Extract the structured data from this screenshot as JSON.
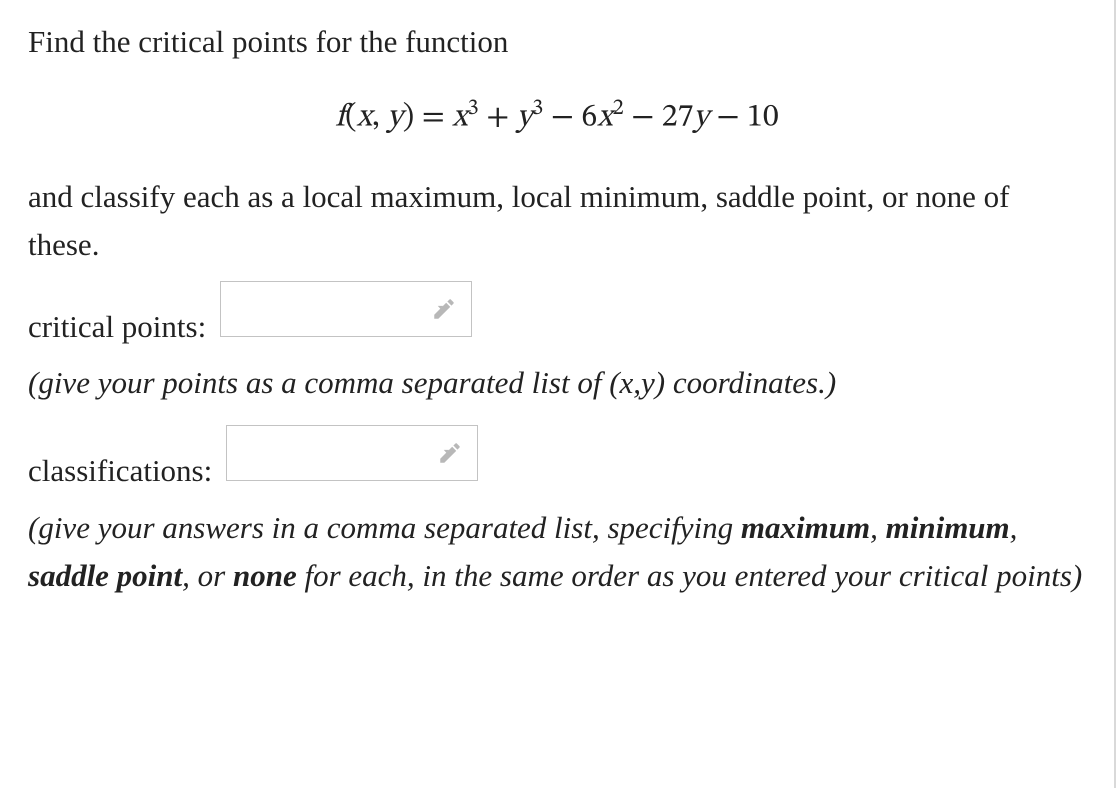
{
  "question": {
    "intro": "Find the critical points for the function",
    "equation_parts": {
      "lhs_f": "f",
      "lhs_open": "(",
      "lhs_x": "x",
      "lhs_comma": ", ",
      "lhs_y": "y",
      "lhs_close": ")",
      "eq": " = ",
      "t1_var": "x",
      "t1_exp": "3",
      "plus1": " + ",
      "t2_var": "y",
      "t2_exp": "3",
      "minus1": " − 6",
      "t3_var": "x",
      "t3_exp": "2",
      "minus2": " − 27",
      "t4_var": "y",
      "tail": " − 10"
    },
    "instruction": "and classify each as a local maximum, local minimum, saddle point, or none of these.",
    "critical_points": {
      "label": "critical points:",
      "value": "",
      "hint": "(give your points as a comma separated list of (x,y) coordinates.)"
    },
    "classifications": {
      "label": "classifications:",
      "value": "",
      "hint_pre": "(give your answers in a comma separated list, specifying ",
      "hint_b1": "maximum",
      "hint_sep1": ", ",
      "hint_b2": "minimum",
      "hint_sep2": ", ",
      "hint_b3": "saddle point",
      "hint_sep3": ", or ",
      "hint_b4": "none",
      "hint_post": " for each, in the same order as you entered your critical points)"
    }
  }
}
